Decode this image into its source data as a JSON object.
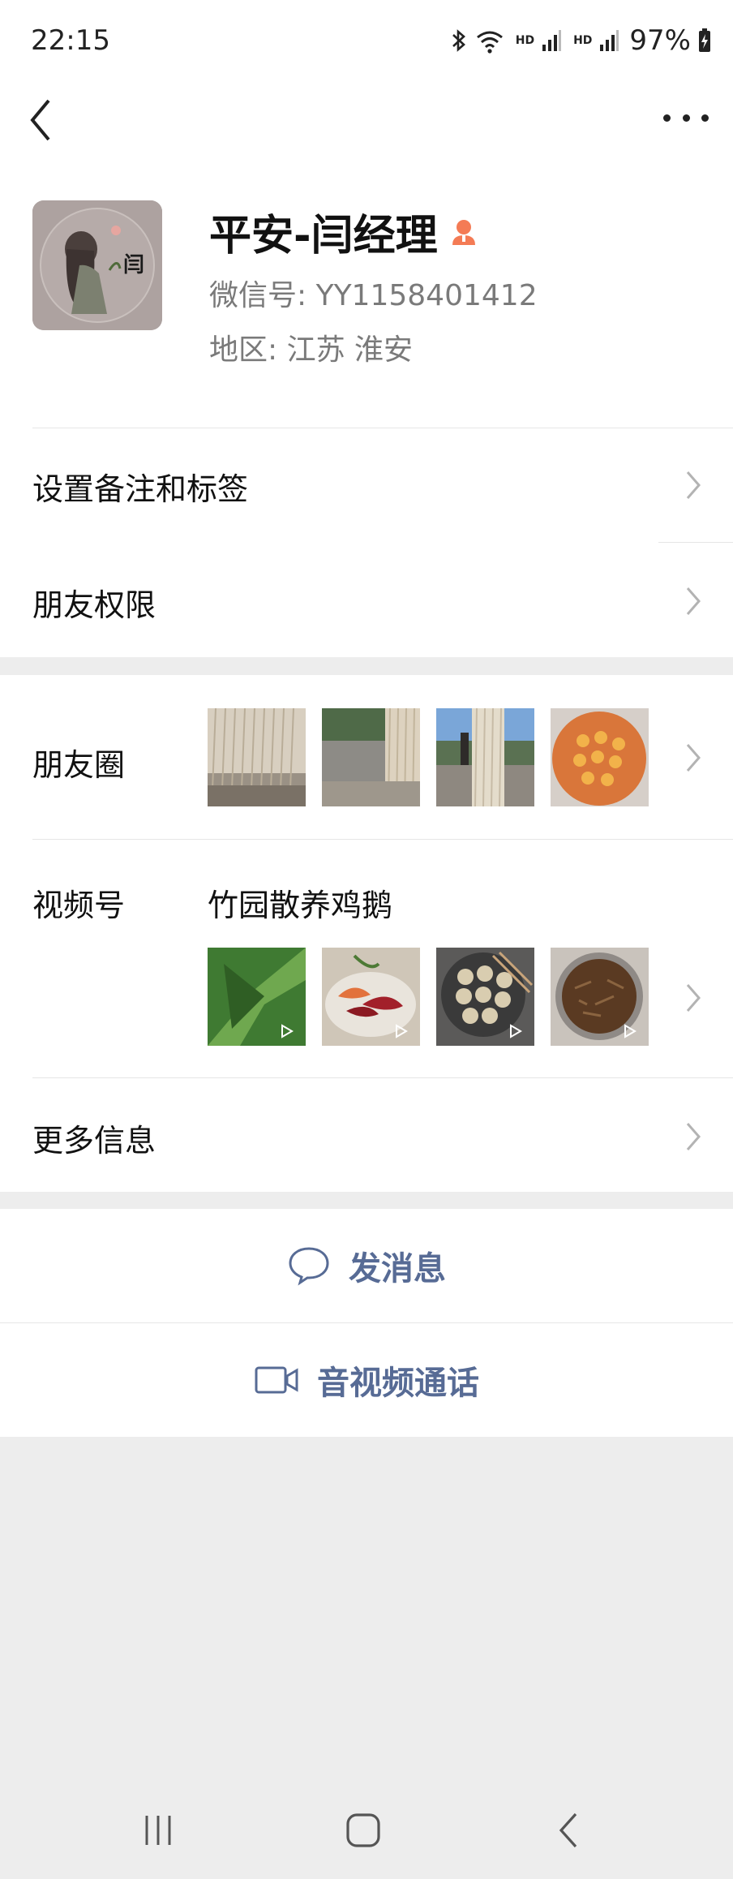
{
  "status_bar": {
    "time": "22:15",
    "battery": "97%",
    "hd1": "HD",
    "hd2": "HD"
  },
  "profile": {
    "nickname": "平安-闫经理",
    "wechat_id": "微信号: YY1158401412",
    "region": "地区: 江苏  淮安",
    "avatar_text": "闫"
  },
  "menu": {
    "remark": "设置备注和标签",
    "permission": "朋友权限",
    "moments": "朋友圈",
    "channels": "视频号",
    "channel_name": "竹园散养鸡鹅",
    "more_info": "更多信息"
  },
  "actions": {
    "message": "发消息",
    "call": "音视频通话"
  },
  "colors": {
    "link": "#576b95",
    "badge": "#f47b55",
    "background": "#ededed"
  }
}
